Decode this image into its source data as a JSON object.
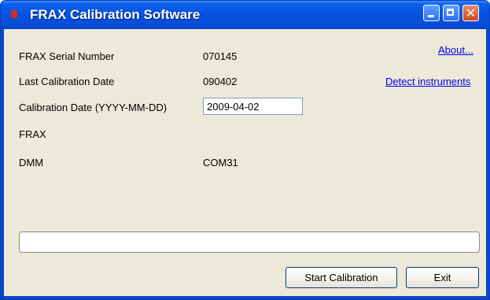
{
  "window": {
    "title": "FRAX Calibration Software",
    "title_color": "#ffffff",
    "titlebar_color": "#0a5ee8",
    "body_color": "#ece9d8"
  },
  "titlebar_buttons": {
    "minimize_icon": "minimize-icon",
    "maximize_icon": "maximize-icon",
    "close_icon": "close-icon",
    "close_glyph": "✕"
  },
  "fields": {
    "serial_label": "FRAX Serial Number",
    "serial_value": "070145",
    "last_cal_label": "Last Calibration Date",
    "last_cal_value": "090402",
    "cal_date_label": "Calibration Date (YYYY-MM-DD)",
    "cal_date_value": "2009-04-02",
    "frax_label": "FRAX",
    "frax_value": "",
    "dmm_label": "DMM",
    "dmm_value": "COM31"
  },
  "links": {
    "about": "About...",
    "detect": "Detect instruments"
  },
  "progress": {
    "fraction": 0
  },
  "buttons": {
    "start": "Start Calibration",
    "exit": "Exit"
  }
}
